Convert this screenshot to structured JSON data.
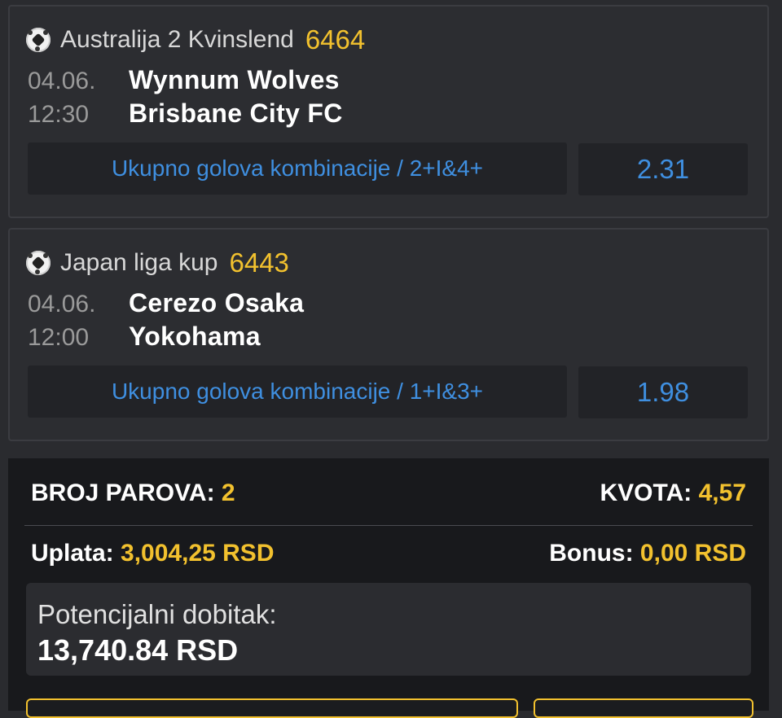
{
  "matches": [
    {
      "icon": "soccer-ball-icon",
      "league": "Australija 2 Kvinslend",
      "code": "6464",
      "date": "04.06.",
      "time": "12:30",
      "home": "Wynnum Wolves",
      "away": "Brisbane City FC",
      "bet": "Ukupno golova kombinacije / 2+I&4+",
      "odd": "2.31"
    },
    {
      "icon": "soccer-ball-icon",
      "league": "Japan liga kup",
      "code": "6443",
      "date": "04.06.",
      "time": "12:00",
      "home": "Cerezo Osaka",
      "away": "Yokohama",
      "bet": "Ukupno golova kombinacije / 1+I&3+",
      "odd": "1.98"
    }
  ],
  "summary": {
    "pairs_label": "BROJ PAROVA:",
    "pairs_value": "2",
    "odds_label": "KVOTA:",
    "odds_value": "4,57",
    "stake_label": "Uplata:",
    "stake_value": "3,004,25 RSD",
    "bonus_label": "Bonus:",
    "bonus_value": "0,00 RSD",
    "potential_label": "Potencijalni dobitak:",
    "potential_value": "13,740.84 RSD"
  },
  "colors": {
    "accent": "#f2c12e",
    "link": "#3f8fe0",
    "background": "#2a2b2f",
    "summary_background": "#18191c"
  }
}
